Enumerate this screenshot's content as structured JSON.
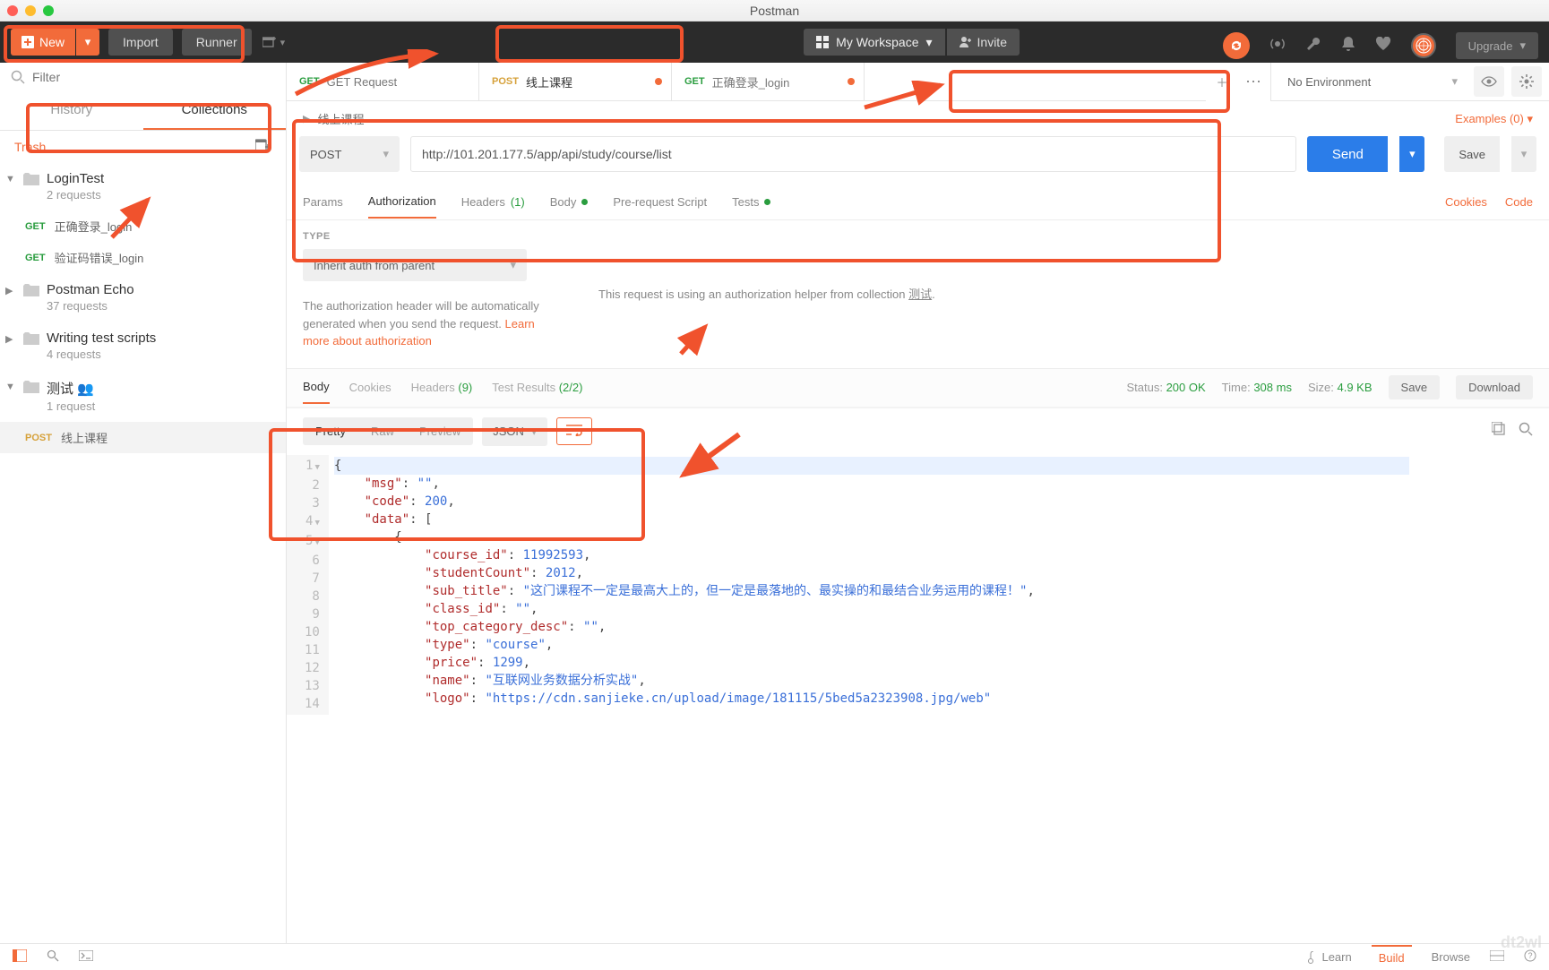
{
  "app": {
    "title": "Postman"
  },
  "topbar": {
    "new": "New",
    "import": "Import",
    "runner": "Runner",
    "workspace": "My Workspace",
    "invite": "Invite",
    "upgrade": "Upgrade"
  },
  "sidebar": {
    "filter_placeholder": "Filter",
    "tabs": {
      "history": "History",
      "collections": "Collections"
    },
    "trash": "Trash",
    "collections": [
      {
        "name": "LoginTest",
        "sub": "2 requests",
        "expanded": true,
        "requests": [
          {
            "method": "GET",
            "name": "正确登录_login"
          },
          {
            "method": "GET",
            "name": "验证码错误_login"
          }
        ]
      },
      {
        "name": "Postman Echo",
        "sub": "37 requests"
      },
      {
        "name": "Writing test scripts",
        "sub": "4 requests"
      },
      {
        "name": "测试",
        "sub": "1 request",
        "shared": true,
        "expanded": true,
        "requests": [
          {
            "method": "POST",
            "name": "线上课程",
            "active": true
          }
        ]
      }
    ]
  },
  "tabs": [
    {
      "method": "GET",
      "name": "GET Request"
    },
    {
      "method": "POST",
      "name": "线上课程",
      "dirty": true,
      "active": true
    },
    {
      "method": "GET",
      "name": "正确登录_login",
      "dirty": true
    }
  ],
  "env": {
    "selected": "No Environment"
  },
  "request": {
    "title": "线上课程",
    "examples": "Examples (0)",
    "method": "POST",
    "url": "http://101.201.177.5/app/api/study/course/list",
    "send": "Send",
    "save": "Save",
    "subtabs": {
      "params": "Params",
      "auth": "Authorization",
      "headers": "Headers",
      "headers_count": "(1)",
      "body": "Body",
      "prerequest": "Pre-request Script",
      "tests": "Tests"
    },
    "subtabs_right": {
      "cookies": "Cookies",
      "code": "Code"
    },
    "auth": {
      "type_label": "TYPE",
      "type_value": "Inherit auth from parent",
      "help1": "The authorization header will be automatically generated when you send the request. ",
      "help_link": "Learn more about authorization",
      "right_text": "This request is using an authorization helper from collection ",
      "right_link": "测试"
    }
  },
  "response": {
    "tabs": {
      "body": "Body",
      "cookies": "Cookies",
      "headers": "Headers",
      "headers_count": "(9)",
      "tests": "Test Results",
      "tests_count": "(2/2)"
    },
    "status_label": "Status:",
    "status_value": "200 OK",
    "time_label": "Time:",
    "time_value": "308 ms",
    "size_label": "Size:",
    "size_value": "4.9 KB",
    "save": "Save",
    "download": "Download",
    "viewmodes": {
      "pretty": "Pretty",
      "raw": "Raw",
      "preview": "Preview"
    },
    "format": "JSON",
    "body_lines": [
      "{",
      "    \"msg\": \"\",",
      "    \"code\": 200,",
      "    \"data\": [",
      "        {",
      "            \"course_id\": 11992593,",
      "            \"studentCount\": 2012,",
      "            \"sub_title\": \"这门课程不一定是最高大上的，但一定是最落地的、最实操的和最结合业务运用的课程！\",",
      "            \"class_id\": \"\",",
      "            \"top_category_desc\": \"\",",
      "            \"type\": \"course\",",
      "            \"price\": 1299,",
      "            \"name\": \"互联网业务数据分析实战\",",
      "            \"logo\": \"https://cdn.sanjieke.cn/upload/image/181115/5bed5a2323908.jpg/web\""
    ]
  },
  "statusbar": {
    "learn": "Learn",
    "build": "Build",
    "browse": "Browse"
  }
}
